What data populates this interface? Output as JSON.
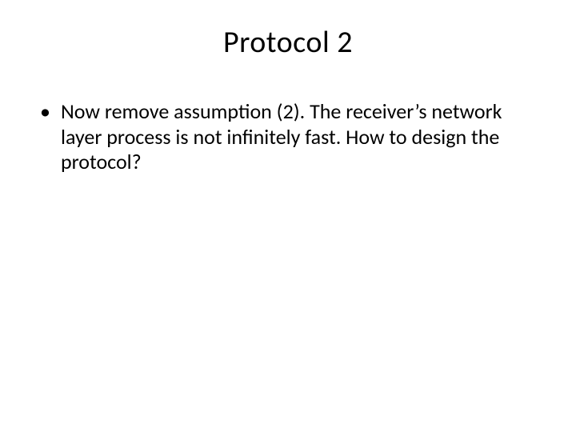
{
  "slide": {
    "title": "Protocol 2",
    "bullets": [
      "Now remove assumption (2).  The receiver’s network layer process is not infinitely fast. How to design the protocol?"
    ]
  }
}
